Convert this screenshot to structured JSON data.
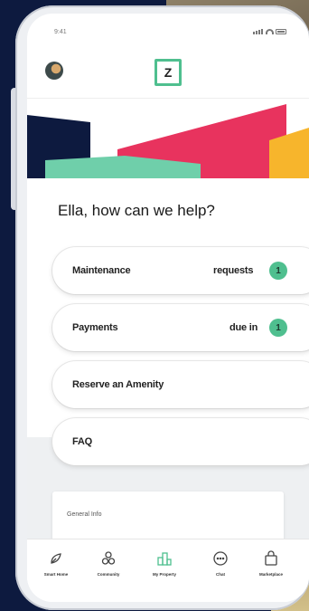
{
  "status": {
    "time": "9:41"
  },
  "header": {
    "logo_letter": "Z"
  },
  "greeting": "Ella, how can we help?",
  "menu": [
    {
      "label": "Maintenance",
      "status": "requests",
      "badge": "1"
    },
    {
      "label": "Payments",
      "status": "due in",
      "badge": "1"
    },
    {
      "label": "Reserve an Amenity"
    },
    {
      "label": "FAQ"
    }
  ],
  "info_card": {
    "title": "General Info"
  },
  "tabs": [
    {
      "label": "Smart Home",
      "icon": "smart-home-icon"
    },
    {
      "label": "Community",
      "icon": "community-icon"
    },
    {
      "label": "My Property",
      "icon": "my-property-icon",
      "active": true
    },
    {
      "label": "Chat",
      "icon": "chat-icon"
    },
    {
      "label": "Marketplace",
      "icon": "marketplace-icon"
    }
  ],
  "colors": {
    "accent": "#4fbf8f",
    "navy": "#0d1a3f",
    "banner_red": "#e8335e",
    "banner_yellow": "#f7b52c",
    "banner_green": "#6fcfaa"
  }
}
